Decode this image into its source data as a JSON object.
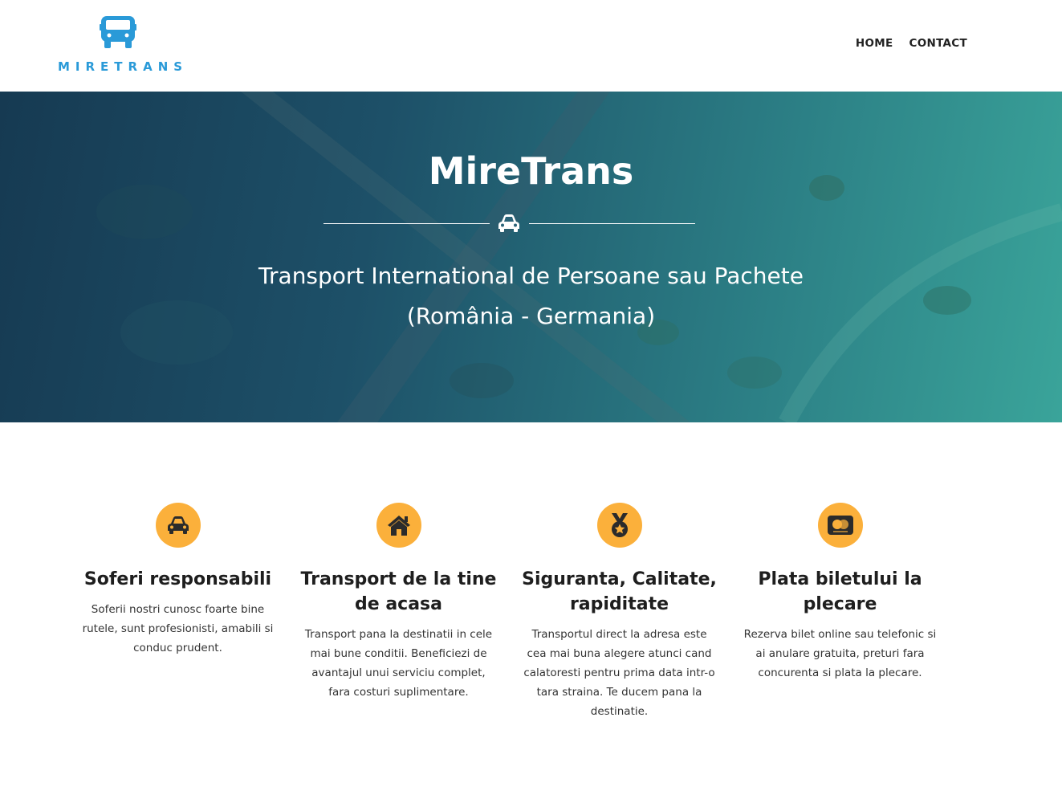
{
  "header": {
    "logo_text": "MIRETRANS",
    "nav": [
      {
        "label": "HOME"
      },
      {
        "label": "CONTACT"
      }
    ]
  },
  "hero": {
    "title": "MireTrans",
    "subtitle_line1": "Transport International de Persoane sau Pachete",
    "subtitle_line2": "(România - Germania)",
    "divider_icon": "car-icon"
  },
  "features": [
    {
      "icon": "car-icon",
      "title": "Soferi responsabili",
      "text": "Soferii nostri cunosc foarte bine rutele, sunt profesionisti, amabili si conduc prudent."
    },
    {
      "icon": "home-icon",
      "title": "Transport de la tine de acasa",
      "text": "Transport pana la destinatii in cele mai bune conditii. Beneficiezi de avantajul unui serviciu complet, fara costuri suplimentare."
    },
    {
      "icon": "medal-icon",
      "title": "Siguranta, Calitate, rapiditate",
      "text": "Transportul direct la adresa este cea mai buna alegere atunci cand calatoresti pentru prima data intr-o tara straina. Te ducem pana la destinatie."
    },
    {
      "icon": "credit-card-icon",
      "title": "Plata biletului la plecare",
      "text": "Rezerva bilet online sau telefonic si ai anulare gratuita, preturi fara concurenta si plata la plecare."
    }
  ],
  "colors": {
    "accent": "#fbb03b",
    "logo_blue": "#2a9ad8",
    "hero_dark": "#163a52",
    "hero_light": "#3aa49a"
  }
}
